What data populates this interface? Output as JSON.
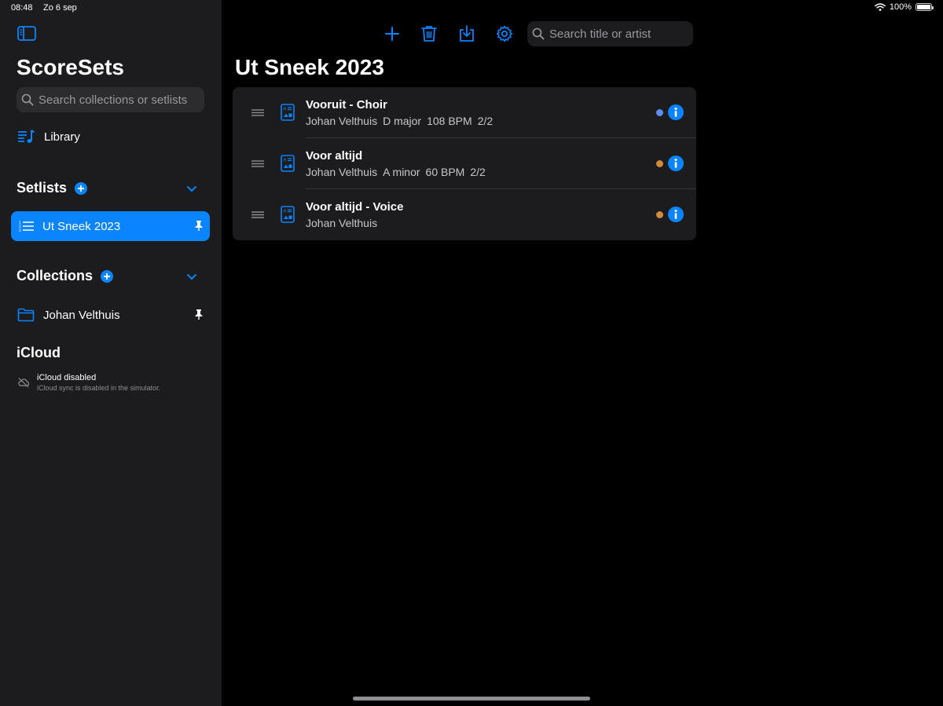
{
  "status_bar": {
    "time": "08:48",
    "date": "Zo 6 sep",
    "battery": "100%"
  },
  "sidebar": {
    "app_title": "ScoreSets",
    "search_placeholder": "Search collections or setlists",
    "library_label": "Library",
    "setlists_title": "Setlists",
    "setlists": [
      {
        "label": "Ut Sneek 2023",
        "selected": true,
        "pinned": true
      }
    ],
    "collections_title": "Collections",
    "collections": [
      {
        "label": "Johan Velthuis",
        "pinned": true
      }
    ],
    "icloud_title": "iCloud",
    "icloud_status": "iCloud disabled",
    "icloud_detail": "iCloud sync is disabled in the simulator."
  },
  "main": {
    "search_placeholder": "Search title or artist",
    "title": "Ut Sneek 2023",
    "songs": [
      {
        "title": "Vooruit - Choir",
        "artist": "Johan Velthuis",
        "key": "D major",
        "tempo": "108 BPM",
        "time_signature": "2/2",
        "dot_color": "#5e8cf5"
      },
      {
        "title": "Voor altijd",
        "artist": "Johan Velthuis",
        "key": "A minor",
        "tempo": "60 BPM",
        "time_signature": "2/2",
        "dot_color": "#d08a3c"
      },
      {
        "title": "Voor altijd - Voice",
        "artist": "Johan Velthuis",
        "key": "",
        "tempo": "",
        "time_signature": "",
        "dot_color": "#d08a3c"
      }
    ]
  },
  "colors": {
    "accent": "#0a84ff",
    "sidebar_bg": "#1c1c1e",
    "background": "#000000"
  },
  "icons": [
    "sidebar-toggle-icon",
    "library-icon",
    "add-circle-icon",
    "chevron-down-icon",
    "list-icon",
    "pin-icon",
    "folder-icon",
    "cloud-off-icon",
    "plus-icon",
    "trash-icon",
    "import-icon",
    "gear-icon",
    "search-icon",
    "drag-handle-icon",
    "document-icon",
    "info-icon",
    "wifi-icon",
    "battery-icon"
  ]
}
